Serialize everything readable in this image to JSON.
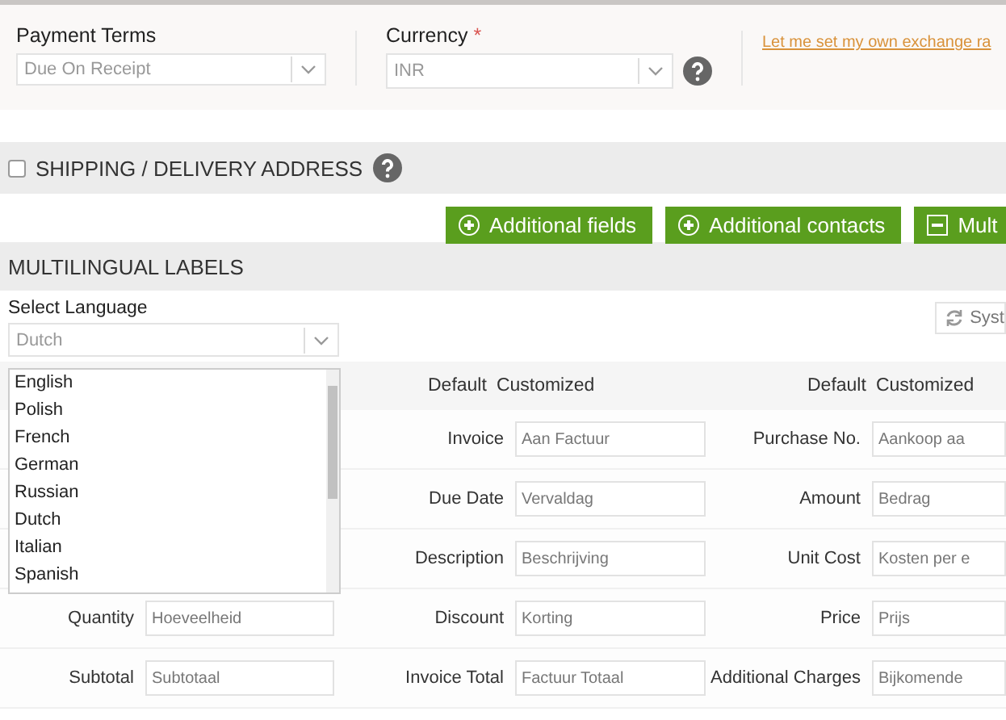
{
  "payment_terms": {
    "label": "Payment Terms",
    "value": "Due On Receipt"
  },
  "currency": {
    "label": "Currency",
    "required_mark": "*",
    "value": "INR"
  },
  "exchange_rate_link": "Let me set my own exchange ra",
  "shipping": {
    "title": "SHIPPING / DELIVERY ADDRESS",
    "checked": false
  },
  "buttons": [
    {
      "label": "Additional fields",
      "kind": "plus"
    },
    {
      "label": "Additional contacts",
      "kind": "plus"
    },
    {
      "label": "Mult",
      "kind": "minus"
    }
  ],
  "multilingual": {
    "title": "MULTILINGUAL LABELS",
    "language_label": "Select Language",
    "language_value": "Dutch",
    "system_button": "Syst",
    "language_options": [
      {
        "label": "English",
        "selected": false
      },
      {
        "label": "Polish",
        "selected": false
      },
      {
        "label": "French",
        "selected": false
      },
      {
        "label": "German",
        "selected": false
      },
      {
        "label": "Russian",
        "selected": false
      },
      {
        "label": "Dutch",
        "selected": false
      },
      {
        "label": "Italian",
        "selected": false
      },
      {
        "label": "Spanish",
        "selected": false
      }
    ],
    "column_headers": [
      {
        "default": "Default",
        "customized": "Customized"
      },
      {
        "default": "Default",
        "customized": "Customized"
      }
    ],
    "rows": [
      {
        "cells": [
          {
            "label": "Invoice",
            "value": "Aan Factuur"
          },
          {
            "label": "Purchase No.",
            "value": "Aankoop aa"
          }
        ]
      },
      {
        "cells": [
          {
            "label": "Due Date",
            "value": "Vervaldag"
          },
          {
            "label": "Amount",
            "value": "Bedrag"
          }
        ]
      },
      {
        "cells": [
          {
            "label": "Description",
            "value": "Beschrijving"
          },
          {
            "label": "Unit Cost",
            "value": "Kosten per e"
          }
        ]
      },
      {
        "cells": [
          {
            "label": "Quantity",
            "value": "Hoeveelheid"
          },
          {
            "label": "Discount",
            "value": "Korting"
          },
          {
            "label": "Price",
            "value": "Prijs"
          }
        ]
      },
      {
        "cells": [
          {
            "label": "Subtotal",
            "value": "Subtotaal"
          },
          {
            "label": "Invoice Total",
            "value": "Factuur Totaal"
          },
          {
            "label": "Additional Charges",
            "value": "Bijkomende"
          }
        ]
      }
    ]
  }
}
